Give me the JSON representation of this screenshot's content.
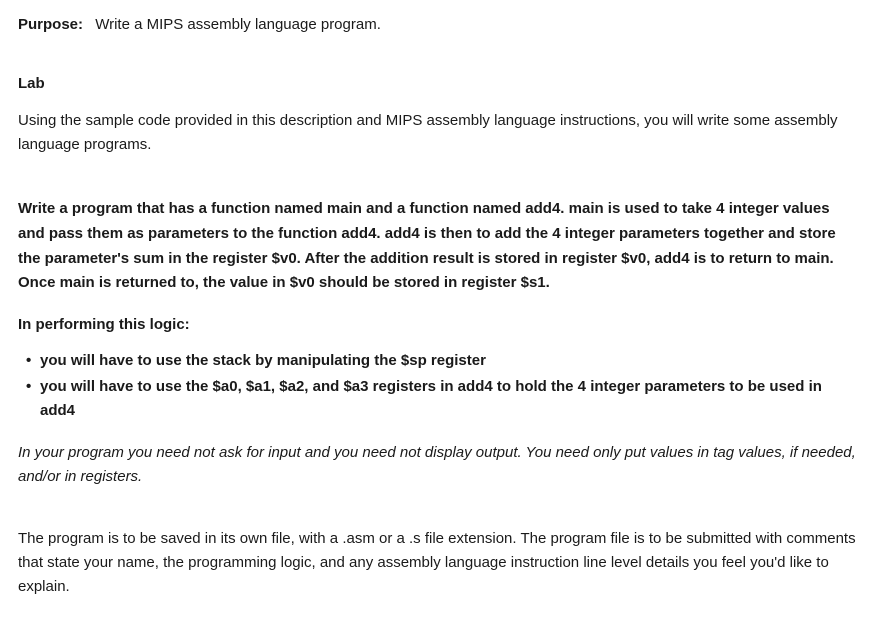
{
  "purpose": {
    "label": "Purpose:",
    "text": "Write a MIPS assembly language program."
  },
  "lab": {
    "heading": "Lab",
    "intro": "Using the sample code provided in this description and MIPS assembly language instructions, you will write some assembly language programs."
  },
  "spec": {
    "main": "Write a program that has a function named main and a function named add4.  main is used to take 4 integer values and pass them as parameters to the function add4.  add4 is then to add the 4 integer parameters together and store the parameter's sum in the register $v0.  After the addition result is stored in register $v0, add4 is to return to main.  Once main is returned to, the value in $v0 should be stored in register $s1.",
    "logic_heading": "In performing this logic:",
    "bullets": [
      "you will have to use the stack by manipulating the $sp register",
      "you will have to use the $a0, $a1, $a2, and $a3 registers in add4 to hold the 4 integer parameters to be used in add4"
    ],
    "note": "In your program you need not ask for input and you need not display output.  You need only put values in tag values, if needed, and/or in registers."
  },
  "closing": "The program is to be saved in its own file, with a .asm or a .s file extension. The program file is to be submitted with comments that state your name, the programming logic, and any assembly language instruction line level details you feel you'd like to explain."
}
